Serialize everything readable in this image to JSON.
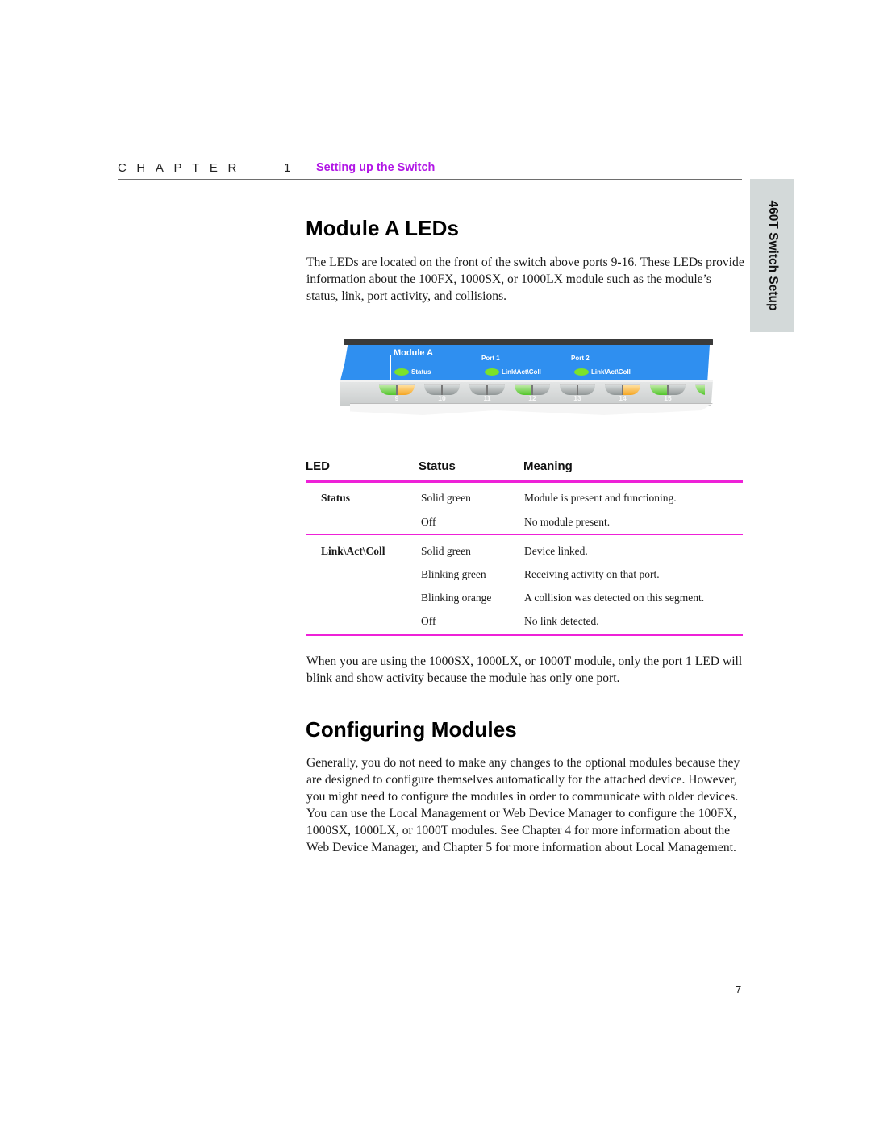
{
  "header": {
    "chapter_word": "CHAPTER",
    "chapter_number": "1",
    "chapter_title": "Setting up the Switch"
  },
  "side_tab": {
    "label": "460T Switch Setup"
  },
  "section1": {
    "title": "Module A LEDs",
    "intro": "The LEDs are located on the front of the switch above ports 9-16. These LEDs provide information about the 100FX, 1000SX, or 1000LX module such as the module’s status, link, port activity, and collisions."
  },
  "panel": {
    "module_label": "Module A",
    "port1_label": "Port 1",
    "port2_label": "Port 2",
    "status_label": "Status",
    "link_label_1": "Link\\Act\\Coll",
    "link_label_2": "Link\\Act\\Coll",
    "led_color": "#7be22a",
    "ports": [
      {
        "number": "9",
        "left": "green",
        "right": "orange"
      },
      {
        "number": "10",
        "left": "off",
        "right": "off"
      },
      {
        "number": "11",
        "left": "off",
        "right": "off"
      },
      {
        "number": "12",
        "left": "green",
        "right": "off"
      },
      {
        "number": "13",
        "left": "off",
        "right": "off"
      },
      {
        "number": "14",
        "left": "off",
        "right": "orange"
      },
      {
        "number": "15",
        "left": "green",
        "right": "off"
      }
    ]
  },
  "led_table": {
    "headers": {
      "led": "LED",
      "status": "Status",
      "meaning": "Meaning"
    },
    "groups": [
      {
        "led": "Status",
        "rows": [
          {
            "status": "Solid green",
            "meaning": "Module is present and functioning."
          },
          {
            "status": "Off",
            "meaning": "No module present."
          }
        ]
      },
      {
        "led": "Link\\Act\\Coll",
        "rows": [
          {
            "status": "Solid green",
            "meaning": "Device linked."
          },
          {
            "status": "Blinking green",
            "meaning": "Receiving activity on that port."
          },
          {
            "status": "Blinking orange",
            "meaning": "A collision was detected on this segment."
          },
          {
            "status": "Off",
            "meaning": "No link detected."
          }
        ]
      }
    ],
    "rule_color": "#ee21d8"
  },
  "note": "When you are using the 1000SX, 1000LX, or 1000T module, only the port 1 LED will blink and show activity because the module has only one port.",
  "section2": {
    "title": "Configuring Modules",
    "body": "Generally, you do not need to make any changes to the optional modules because they are designed to configure themselves automatically for the attached device. However, you might need to configure the modules in order to communicate with older devices. You can use the Local Management or Web Device Manager to configure the 100FX, 1000SX, 1000LX, or 1000T modules.  See Chapter 4 for more information about the Web Device Manager, and Chapter 5 for more information about Local Management."
  },
  "footer": {
    "page_number": "7"
  },
  "colors": {
    "chapter_title": "#b217e6",
    "panel_blue": "#2f8ff0",
    "side_tab_bg": "#d3d9d9"
  }
}
